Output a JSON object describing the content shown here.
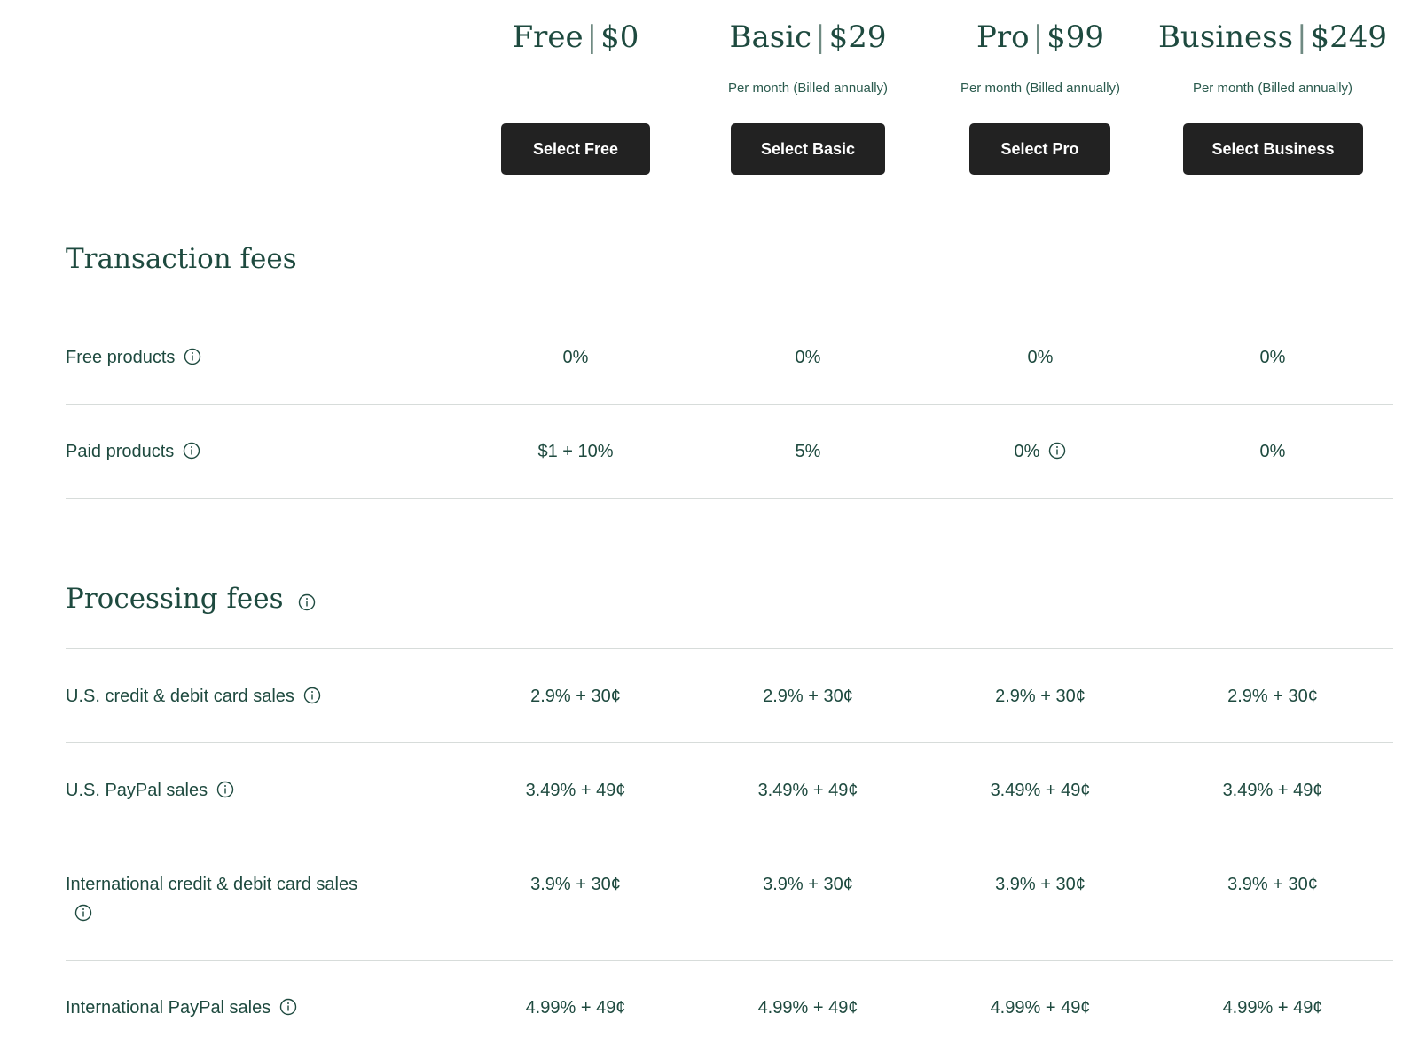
{
  "plans": [
    {
      "name": "Free",
      "price": "$0",
      "billing": "",
      "button": "Select Free"
    },
    {
      "name": "Basic",
      "price": "$29",
      "billing": "Per month (Billed annually)",
      "button": "Select Basic"
    },
    {
      "name": "Pro",
      "price": "$99",
      "billing": "Per month (Billed annually)",
      "button": "Select Pro"
    },
    {
      "name": "Business",
      "price": "$249",
      "billing": "Per month (Billed annually)",
      "button": "Select Business"
    }
  ],
  "sections": {
    "transaction": {
      "title": "Transaction fees",
      "rows": [
        {
          "label": "Free products",
          "values": [
            "0%",
            "0%",
            "0%",
            "0%"
          ]
        },
        {
          "label": "Paid products",
          "values": [
            "$1 + 10%",
            "5%",
            "0%",
            "0%"
          ]
        }
      ]
    },
    "processing": {
      "title": "Processing fees",
      "rows": [
        {
          "label": "U.S. credit & debit card sales",
          "values": [
            "2.9% + 30¢",
            "2.9% + 30¢",
            "2.9% + 30¢",
            "2.9% + 30¢"
          ]
        },
        {
          "label": "U.S. PayPal sales",
          "values": [
            "3.49% + 49¢",
            "3.49% + 49¢",
            "3.49% + 49¢",
            "3.49% + 49¢"
          ]
        },
        {
          "label": "International credit & debit card sales",
          "values": [
            "3.9% + 30¢",
            "3.9% + 30¢",
            "3.9% + 30¢",
            "3.9% + 30¢"
          ]
        },
        {
          "label": "International PayPal sales",
          "values": [
            "4.99% + 49¢",
            "4.99% + 49¢",
            "4.99% + 49¢",
            "4.99% + 49¢"
          ]
        }
      ]
    }
  },
  "icons": {
    "info": "info-circle-icon"
  },
  "colors": {
    "text": "#1e4a3f",
    "button_bg": "#222222",
    "button_text": "#ffffff",
    "divider": "#d7dcda"
  }
}
